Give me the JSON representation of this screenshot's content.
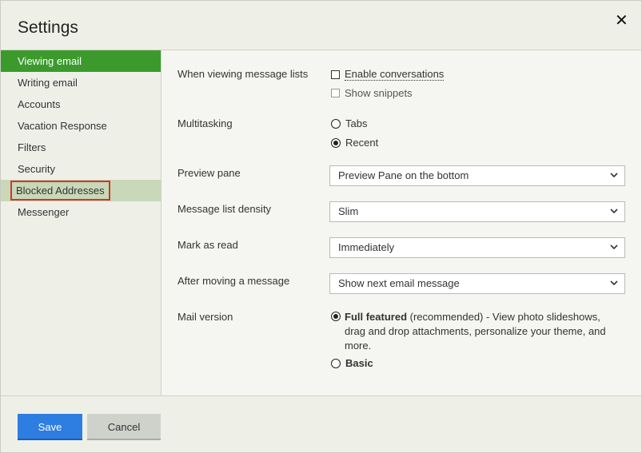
{
  "dialog": {
    "title": "Settings",
    "close_label": "✕"
  },
  "sidebar": {
    "items": [
      {
        "label": "Viewing email"
      },
      {
        "label": "Writing email"
      },
      {
        "label": "Accounts"
      },
      {
        "label": "Vacation Response"
      },
      {
        "label": "Filters"
      },
      {
        "label": "Security"
      },
      {
        "label": "Blocked Addresses"
      },
      {
        "label": "Messenger"
      }
    ]
  },
  "settings": {
    "message_lists": {
      "label": "When viewing message lists",
      "enable_conversations": "Enable conversations",
      "show_snippets": "Show snippets"
    },
    "multitasking": {
      "label": "Multitasking",
      "tabs": "Tabs",
      "recent": "Recent"
    },
    "preview_pane": {
      "label": "Preview pane",
      "value": "Preview Pane on the bottom"
    },
    "density": {
      "label": "Message list density",
      "value": "Slim"
    },
    "mark_read": {
      "label": "Mark as read",
      "value": "Immediately"
    },
    "after_moving": {
      "label": "After moving a message",
      "value": "Show next email message"
    },
    "mail_version": {
      "label": "Mail version",
      "full_bold": "Full featured",
      "full_rest": " (recommended) - View photo slideshows, drag and drop attachments, personalize your theme, and more.",
      "basic": "Basic"
    }
  },
  "footer": {
    "save_label": "Save",
    "cancel_label": "Cancel"
  },
  "colors": {
    "accent_green": "#3c9a2d",
    "save_blue": "#2e7de0",
    "highlight_red": "#d0362b"
  }
}
